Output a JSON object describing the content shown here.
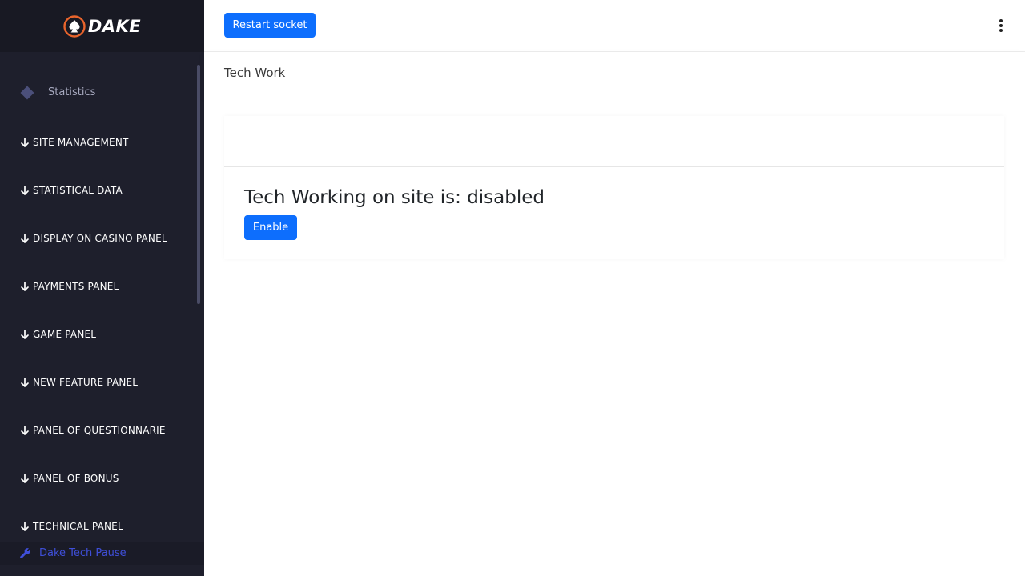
{
  "brand": {
    "logo_text": "DAKE"
  },
  "sidebar": {
    "stats_label": "Statistics",
    "sections": [
      {
        "label": "SITE MANAGEMENT"
      },
      {
        "label": "STATISTICAL DATA"
      },
      {
        "label": "DISPLAY ON CASINO PANEL"
      },
      {
        "label": "PAYMENTS PANEL"
      },
      {
        "label": "GAME PANEL"
      },
      {
        "label": "NEW FEATURE PANEL"
      },
      {
        "label": "PANEL OF QUESTIONNARIE"
      },
      {
        "label": "PANEL OF BONUS"
      },
      {
        "label": "TECHNICAL PANEL"
      }
    ],
    "active_item": {
      "label": "Dake Tech Pause",
      "icon": "wrench-icon"
    }
  },
  "topbar": {
    "restart_label": "Restart socket"
  },
  "page": {
    "title": "Tech Work"
  },
  "tech_work": {
    "status_text": "Tech Working on site is: disabled",
    "enable_label": "Enable"
  },
  "colors": {
    "sidebar_bg": "#1e1f2c",
    "primary": "#0d6efd",
    "active_link": "#3f4fd9"
  }
}
